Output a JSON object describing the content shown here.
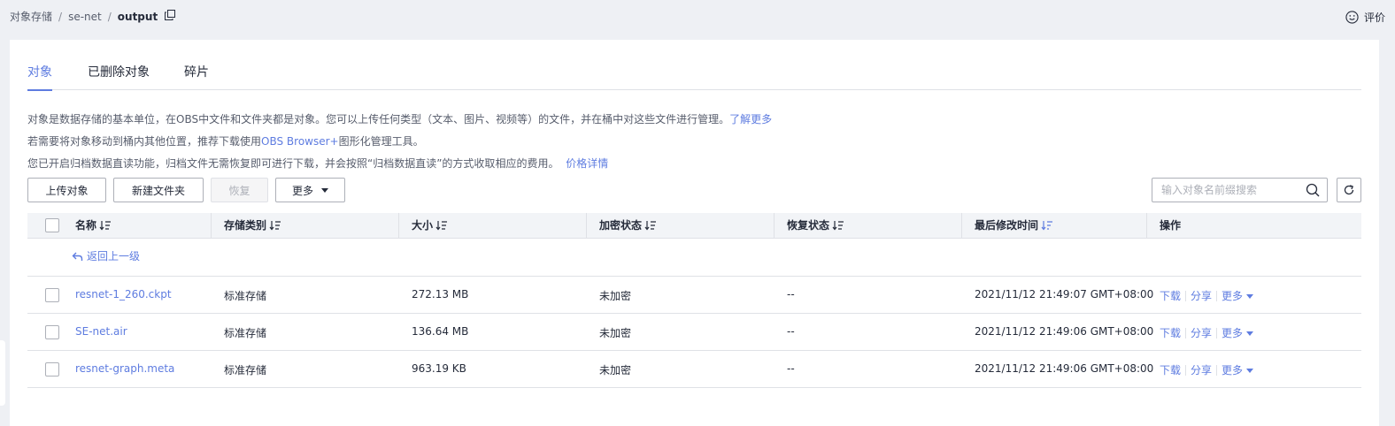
{
  "breadcrumb": {
    "root": "对象存储",
    "bucket": "se-net",
    "current": "output",
    "separator": "/"
  },
  "feedback": {
    "label": "评价"
  },
  "tabs": [
    {
      "label": "对象",
      "active": true
    },
    {
      "label": "已删除对象",
      "active": false
    },
    {
      "label": "碎片",
      "active": false
    }
  ],
  "info": {
    "line1": "对象是数据存储的基本单位，在OBS中文件和文件夹都是对象。您可以上传任何类型（文本、图片、视频等）的文件，并在桶中对这些文件进行管理。",
    "line1_link": "了解更多",
    "line2_prefix": "若需要将对象移动到桶内其他位置，推荐下载使用",
    "line2_link": "OBS Browser+",
    "line2_suffix": "图形化管理工具。",
    "line3": "您已开启归档数据直读功能，归档文件无需恢复即可进行下载，并会按照“归档数据直读”的方式收取相应的费用。",
    "line3_link": "价格详情"
  },
  "toolbar": {
    "upload": "上传对象",
    "new_folder": "新建文件夹",
    "restore": "恢复",
    "more": "更多",
    "search_placeholder": "输入对象名前缀搜索"
  },
  "table": {
    "columns": {
      "name": "名称",
      "storage_class": "存储类别",
      "size": "大小",
      "encryption": "加密状态",
      "restore_status": "恢复状态",
      "modified": "最后修改时间",
      "actions": "操作"
    },
    "back_label": "返回上一级",
    "rows": [
      {
        "name": "resnet-1_260.ckpt",
        "storage_class": "标准存储",
        "size": "272.13 MB",
        "encryption": "未加密",
        "restore_status": "--",
        "modified": "2021/11/12 21:49:07 GMT+08:00"
      },
      {
        "name": "SE-net.air",
        "storage_class": "标准存储",
        "size": "136.64 MB",
        "encryption": "未加密",
        "restore_status": "--",
        "modified": "2021/11/12 21:49:06 GMT+08:00"
      },
      {
        "name": "resnet-graph.meta",
        "storage_class": "标准存储",
        "size": "963.19 KB",
        "encryption": "未加密",
        "restore_status": "--",
        "modified": "2021/11/12 21:49:06 GMT+08:00"
      }
    ],
    "row_actions": {
      "download": "下载",
      "share": "分享",
      "more": "更多"
    }
  },
  "colors": {
    "accent": "#5e7ce0",
    "border": "#dfe1e6",
    "header_bg": "#f2f4f7",
    "page_bg": "#eef0f4"
  }
}
